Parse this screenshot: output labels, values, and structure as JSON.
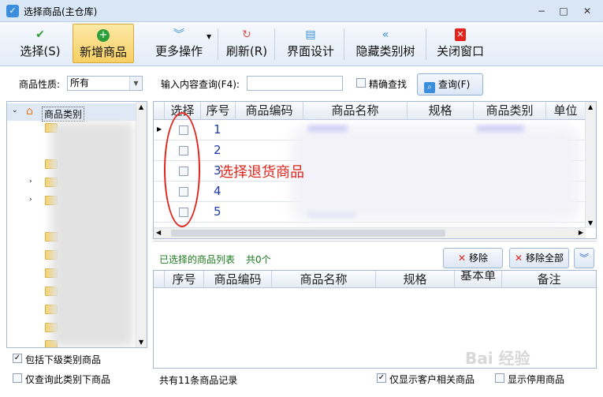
{
  "window": {
    "title": "选择商品(主仓库)",
    "minimize": "−",
    "maximize": "□",
    "close": "✕"
  },
  "toolbar": {
    "select_label": "选择(S)",
    "add_label": "新增商品",
    "more_label": "更多操作",
    "refresh_label": "刷新(R)",
    "design_label": "界面设计",
    "hide_tree_label": "隐藏类别树",
    "close_label": "关闭窗口"
  },
  "filters": {
    "nature_label": "商品性质:",
    "nature_value": "所有",
    "query_label": "输入内容查询(F4):",
    "query_value": "",
    "exact_label": "精确查找",
    "query_button": "查询(F)"
  },
  "tree": {
    "root_label": "商品类别",
    "include_sub_label": "包括下级类别商品",
    "only_category_label": "仅查询此类别下商品"
  },
  "grid": {
    "columns": [
      "选择",
      "序号",
      "商品编码",
      "商品名称",
      "规格",
      "商品类别",
      "单位"
    ],
    "rows": [
      {
        "no": "1"
      },
      {
        "no": "2"
      },
      {
        "no": "3"
      },
      {
        "no": "4"
      },
      {
        "no": "5"
      }
    ]
  },
  "annotation": {
    "text": "选择退货商品"
  },
  "selected": {
    "title": "已选择的商品列表",
    "count": "共0个",
    "remove_label": "移除",
    "remove_all_label": "移除全部",
    "columns": [
      "序号",
      "商品编码",
      "商品名称",
      "规格",
      "基本单",
      "备注"
    ]
  },
  "status": {
    "record_count": "共有11条商品记录",
    "show_customer_label": "仅显示客户相关商品",
    "show_disabled_label": "显示停用商品"
  },
  "watermark": "Bai 经验",
  "colors": {
    "accent": "#3a8edb",
    "annotation": "#e0241c",
    "row_number": "#1f3aa8",
    "selected_title": "#1a7a1a"
  }
}
